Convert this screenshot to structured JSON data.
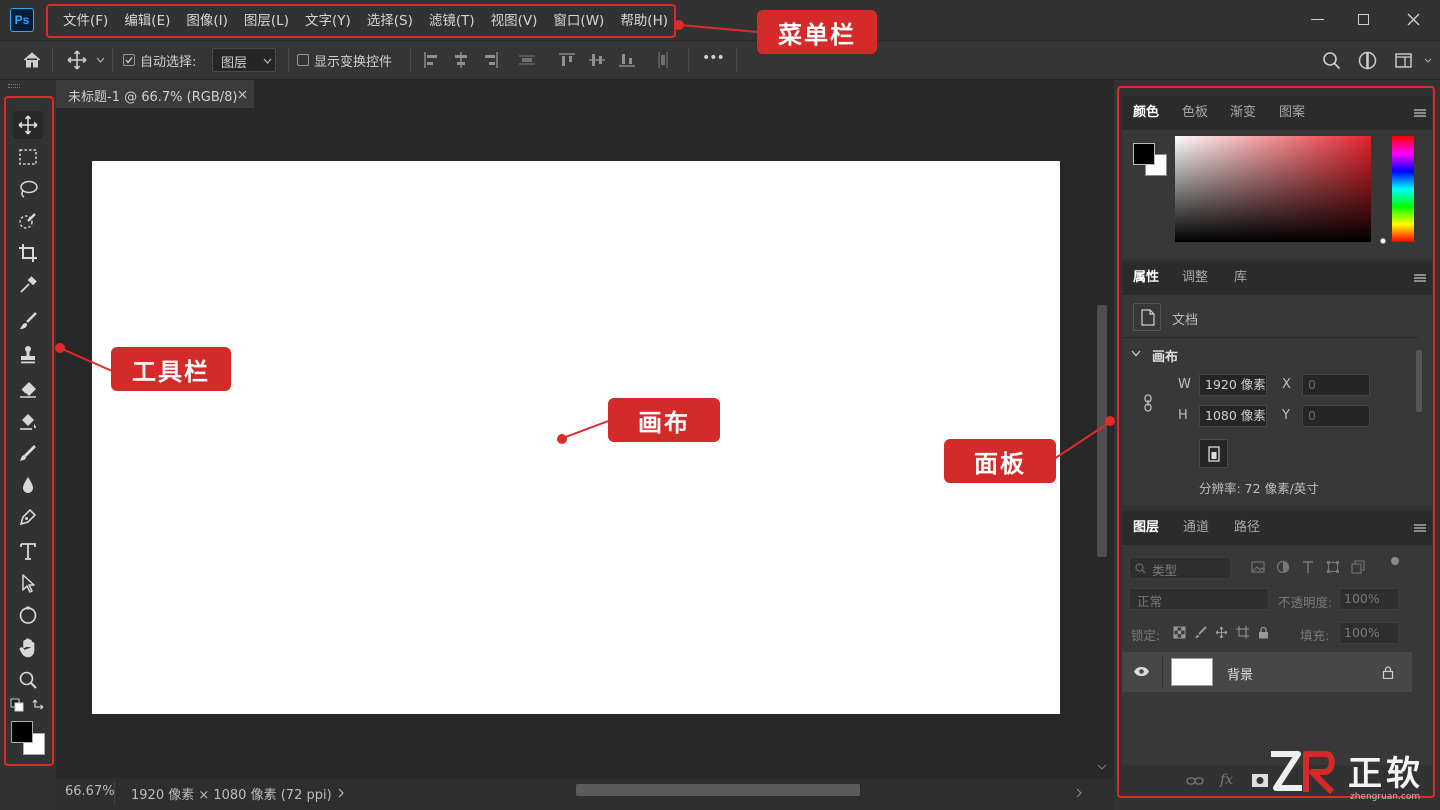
{
  "app": {
    "logo": "Ps"
  },
  "menu": [
    "文件(F)",
    "编辑(E)",
    "图像(I)",
    "图层(L)",
    "文字(Y)",
    "选择(S)",
    "滤镜(T)",
    "视图(V)",
    "窗口(W)",
    "帮助(H)"
  ],
  "options_bar": {
    "auto_select_label": "自动选择:",
    "auto_select_value": "图层",
    "show_transform_label": "显示变换控件",
    "more_label": "•••"
  },
  "document": {
    "tab_title": "未标题-1 @ 66.7% (RGB/8)",
    "zoom": "66.67%",
    "dimensions": "1920 像素 × 1080 像素 (72 ppi)"
  },
  "color_panel": {
    "tabs": [
      "颜色",
      "色板",
      "渐变",
      "图案"
    ],
    "foreground": "#000000",
    "background": "#ffffff"
  },
  "properties_panel": {
    "tabs": [
      "属性",
      "调整",
      "库"
    ],
    "doc_label": "文档",
    "section": "画布",
    "w_label": "W",
    "w_value": "1920 像素",
    "h_label": "H",
    "h_value": "1080 像素",
    "x_label": "X",
    "x_value": "0",
    "y_label": "Y",
    "y_value": "0",
    "resolution": "分辨率: 72 像素/英寸"
  },
  "layers_panel": {
    "tabs": [
      "图层",
      "通道",
      "路径"
    ],
    "filter_placeholder": "类型",
    "blend_mode": "正常",
    "opacity_label": "不透明度:",
    "opacity_value": "100%",
    "lock_label": "锁定:",
    "fill_label": "填充:",
    "fill_value": "100%",
    "layer_name": "背景"
  },
  "annotations": {
    "menu_bar": "菜单栏",
    "toolbar": "工具栏",
    "canvas": "画布",
    "panels": "面板"
  },
  "watermark": {
    "text": "正软",
    "sub": "zhengruan.com"
  },
  "colors": {
    "accent_red": "#e02a2a",
    "callout_red": "#d42a2a",
    "ps_blue": "#31a8ff"
  }
}
